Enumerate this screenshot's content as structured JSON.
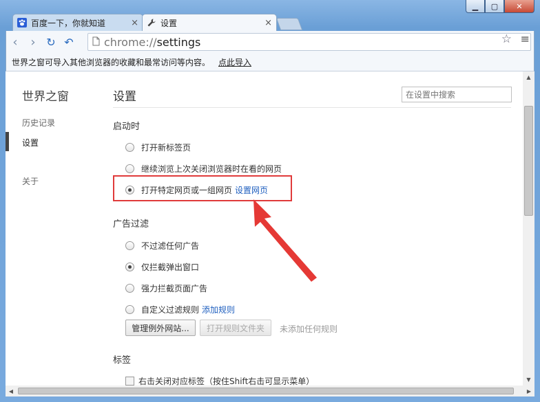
{
  "window": {
    "controls": {
      "minimize": "▁",
      "maximize": "▢",
      "close": "✕"
    }
  },
  "tabs": [
    {
      "title": "百度一下，你就知道",
      "icon": "paw-icon",
      "close": "×"
    },
    {
      "title": "设置",
      "icon": "wrench-icon",
      "close": "×"
    }
  ],
  "toolbar": {
    "back": "‹",
    "forward": "›",
    "reload": "↻",
    "undo": "↶",
    "url_scheme": "chrome://",
    "url_path": "settings",
    "star": "☆",
    "menu": "≡"
  },
  "infobar": {
    "message": "世界之窗可导入其他浏览器的收藏和最常访问等内容。",
    "link": "点此导入"
  },
  "sidebar": {
    "brand": "世界之窗",
    "items": [
      {
        "label": "历史记录"
      },
      {
        "label": "设置"
      },
      {
        "label": "关于"
      }
    ]
  },
  "main": {
    "title": "设置",
    "search_placeholder": "在设置中搜索",
    "startup": {
      "heading": "启动时",
      "options": [
        {
          "label": "打开新标签页",
          "checked": false
        },
        {
          "label": "继续浏览上次关闭浏览器时在看的网页",
          "checked": false
        },
        {
          "label": "打开特定网页或一组网页",
          "checked": true,
          "link": "设置网页"
        }
      ]
    },
    "adblock": {
      "heading": "广告过滤",
      "options": [
        {
          "label": "不过滤任何广告",
          "checked": false
        },
        {
          "label": "仅拦截弹出窗口",
          "checked": true
        },
        {
          "label": "强力拦截页面广告",
          "checked": false
        },
        {
          "label": "自定义过滤规则",
          "checked": false,
          "link": "添加规则"
        }
      ],
      "buttons": {
        "manage": "管理例外网站...",
        "open_folder": "打开规则文件夹"
      },
      "hint": "未添加任何规则"
    },
    "tabs_section": {
      "heading": "标签",
      "checkbox": "右击关闭对应标签（按住Shift右击可显示菜单）"
    }
  },
  "colors": {
    "highlight": "#e03a3a",
    "link": "#1f5fbf"
  }
}
